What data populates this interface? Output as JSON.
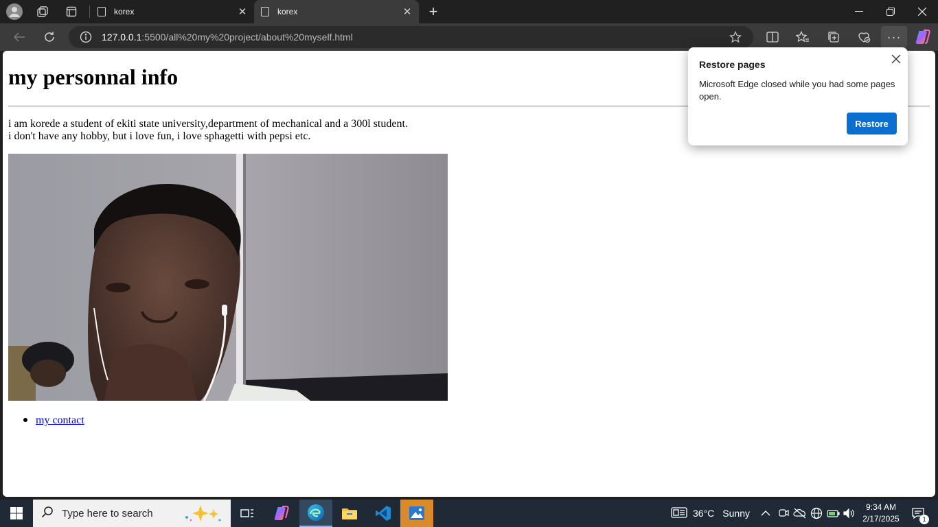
{
  "browser": {
    "tabs": [
      {
        "title": "korex",
        "active": false
      },
      {
        "title": "korex",
        "active": true
      }
    ],
    "new_tab_symbol": "+",
    "url_host": "127.0.0.1",
    "url_rest": ":5500/all%20my%20project/about%20myself.html",
    "accent_color": "#0a6fd0"
  },
  "page": {
    "heading": "my personnal info",
    "bio_line1": "i am korede a student of ekiti state university,department of mechanical and a 300l student.",
    "bio_line2": "i don't have any hobby, but i love fun, i love sphagetti with pepsi etc.",
    "contact_link": "my contact"
  },
  "restore_popup": {
    "title": "Restore pages",
    "message": "Microsoft Edge closed while you had some pages open.",
    "button": "Restore"
  },
  "taskbar": {
    "search_placeholder": "Type here to search",
    "weather_temp": "36°C",
    "weather_text": "Sunny",
    "time": "9:34 AM",
    "date": "2/17/2025",
    "notification_count": "1"
  }
}
